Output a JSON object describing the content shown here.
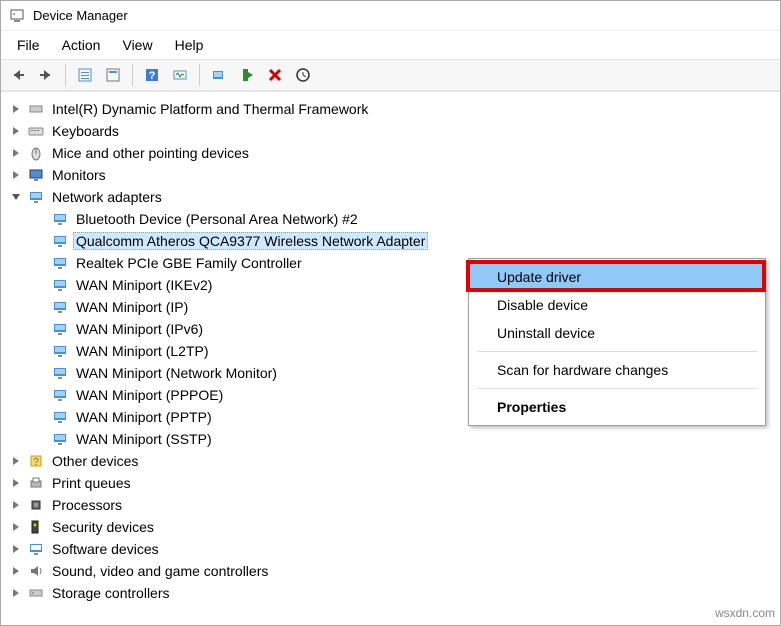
{
  "window": {
    "title": "Device Manager"
  },
  "menubar": {
    "file": "File",
    "action": "Action",
    "view": "View",
    "help": "Help"
  },
  "tree": {
    "intel_dynamic": "Intel(R) Dynamic Platform and Thermal Framework",
    "keyboards": "Keyboards",
    "mice": "Mice and other pointing devices",
    "monitors": "Monitors",
    "network_adapters": "Network adapters",
    "na": {
      "bluetooth": "Bluetooth Device (Personal Area Network) #2",
      "qualcomm": "Qualcomm Atheros QCA9377 Wireless Network Adapter",
      "realtek": "Realtek PCIe GBE Family Controller",
      "wan_ikev2": "WAN Miniport (IKEv2)",
      "wan_ip": "WAN Miniport (IP)",
      "wan_ipv6": "WAN Miniport (IPv6)",
      "wan_l2tp": "WAN Miniport (L2TP)",
      "wan_netmon": "WAN Miniport (Network Monitor)",
      "wan_pppoe": "WAN Miniport (PPPOE)",
      "wan_pptp": "WAN Miniport (PPTP)",
      "wan_sstp": "WAN Miniport (SSTP)"
    },
    "other_devices": "Other devices",
    "print_queues": "Print queues",
    "processors": "Processors",
    "security_devices": "Security devices",
    "software_devices": "Software devices",
    "sound": "Sound, video and game controllers",
    "storage": "Storage controllers"
  },
  "context": {
    "update": "Update driver",
    "disable": "Disable device",
    "uninstall": "Uninstall device",
    "scan": "Scan for hardware changes",
    "properties": "Properties"
  },
  "watermark": "wsxdn.com"
}
